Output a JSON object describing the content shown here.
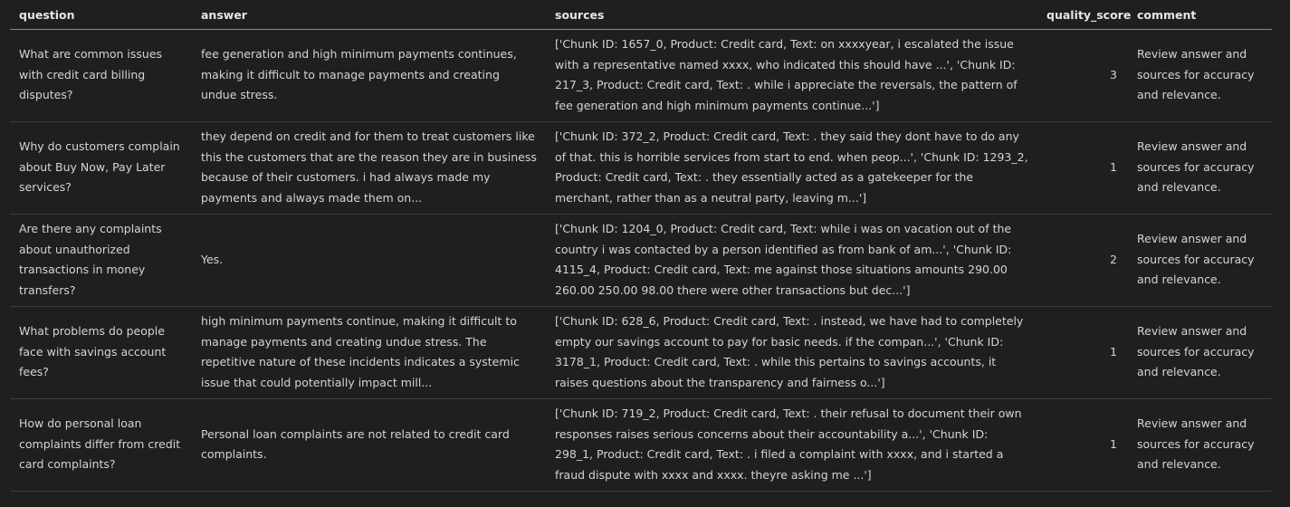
{
  "table": {
    "headers": [
      "question",
      "answer",
      "sources",
      "quality_score",
      "comment"
    ],
    "rows": [
      {
        "question": "What are common issues with credit card billing disputes?",
        "answer": "fee generation and high minimum payments continues, making it difficult to manage payments and creating undue stress.",
        "sources": "['Chunk ID: 1657_0, Product: Credit card, Text: on xxxxyear, i escalated the issue with a representative named xxxx, who indicated this should have ...', 'Chunk ID: 217_3, Product: Credit card, Text: . while i appreciate the reversals, the pattern of fee generation and high minimum payments continue...']",
        "quality_score": "3",
        "comment": "Review answer and sources for accuracy and relevance."
      },
      {
        "question": "Why do customers complain about Buy Now, Pay Later services?",
        "answer": "they depend on credit and for them to treat customers like this the customers that are the reason they are in business because of their customers. i had always made my payments and always made them on...",
        "sources": "['Chunk ID: 372_2, Product: Credit card, Text: . they said they dont have to do any of that. this is horrible services from start to end. when peop...', 'Chunk ID: 1293_2, Product: Credit card, Text: . they essentially acted as a gatekeeper for the merchant, rather than as a neutral party, leaving m...']",
        "quality_score": "1",
        "comment": "Review answer and sources for accuracy and relevance."
      },
      {
        "question": "Are there any complaints about unauthorized transactions in money transfers?",
        "answer": "Yes.",
        "sources": "['Chunk ID: 1204_0, Product: Credit card, Text: while i was on vacation out of the country i was contacted by a person identified as from bank of am...', 'Chunk ID: 4115_4, Product: Credit card, Text: me against those situations amounts 290.00 260.00 250.00 98.00 there were other transactions but dec...']",
        "quality_score": "2",
        "comment": "Review answer and sources for accuracy and relevance."
      },
      {
        "question": "What problems do people face with savings account fees?",
        "answer": "high minimum payments continue, making it difficult to manage payments and creating undue stress. The repetitive nature of these incidents indicates a systemic issue that could potentially impact mill...",
        "sources": "['Chunk ID: 628_6, Product: Credit card, Text: . instead, we have had to completely empty our savings account to pay for basic needs. if the compan...', 'Chunk ID: 3178_1, Product: Credit card, Text: . while this pertains to savings accounts, it raises questions about the transparency and fairness o...']",
        "quality_score": "1",
        "comment": "Review answer and sources for accuracy and relevance."
      },
      {
        "question": "How do personal loan complaints differ from credit card complaints?",
        "answer": "Personal loan complaints are not related to credit card complaints.",
        "sources": "['Chunk ID: 719_2, Product: Credit card, Text: . their refusal to document their own responses raises serious concerns about their accountability a...', 'Chunk ID: 298_1, Product: Credit card, Text: . i filed a complaint with xxxx, and i started a fraud dispute with xxxx and xxxx. theyre asking me ...']",
        "quality_score": "1",
        "comment": "Review answer and sources for accuracy and relevance."
      }
    ]
  }
}
